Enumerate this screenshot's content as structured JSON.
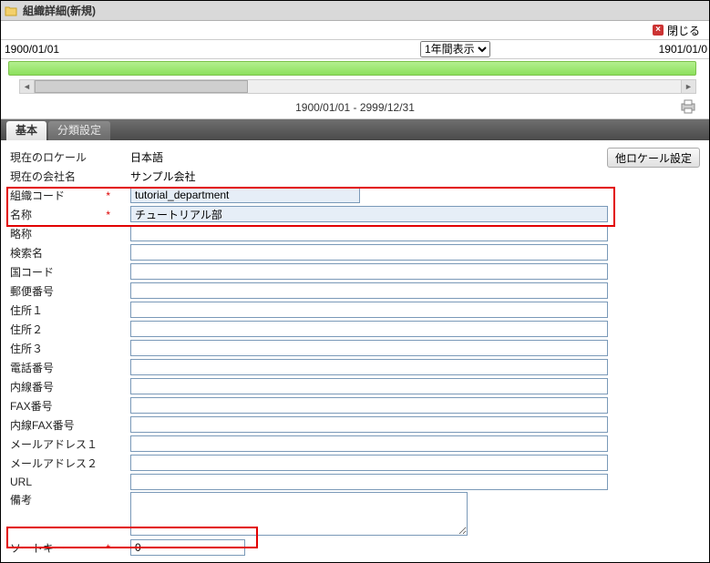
{
  "title": "組織詳細(新規)",
  "close_label": "閉じる",
  "date_left": "1900/01/01",
  "date_right": "1901/01/0",
  "range_dropdown": "1年間表示",
  "date_range_text": "1900/01/01 - 2999/12/31",
  "tabs": {
    "basic": "基本",
    "cat": "分類設定"
  },
  "locale_btn": "他ロケール設定",
  "labels": {
    "current_locale": "現在のロケール",
    "current_company": "現在の会社名",
    "org_code": "組織コード",
    "name": "名称",
    "abbr": "略称",
    "search_name": "検索名",
    "country_code": "国コード",
    "postal_code": "郵便番号",
    "addr1": "住所１",
    "addr2": "住所２",
    "addr3": "住所３",
    "phone": "電話番号",
    "ext": "内線番号",
    "fax": "FAX番号",
    "ext_fax": "内線FAX番号",
    "email1": "メールアドレス１",
    "email2": "メールアドレス２",
    "url": "URL",
    "memo": "備考",
    "sort_key": "ソートキー"
  },
  "values": {
    "current_locale": "日本語",
    "current_company": "サンプル会社",
    "org_code": "tutorial_department",
    "name": "チュートリアル部",
    "abbr": "",
    "search_name": "",
    "country_code": "",
    "postal_code": "",
    "addr1": "",
    "addr2": "",
    "addr3": "",
    "phone": "",
    "ext": "",
    "fax": "",
    "ext_fax": "",
    "email1": "",
    "email2": "",
    "url": "",
    "memo": "",
    "sort_key": "0"
  }
}
